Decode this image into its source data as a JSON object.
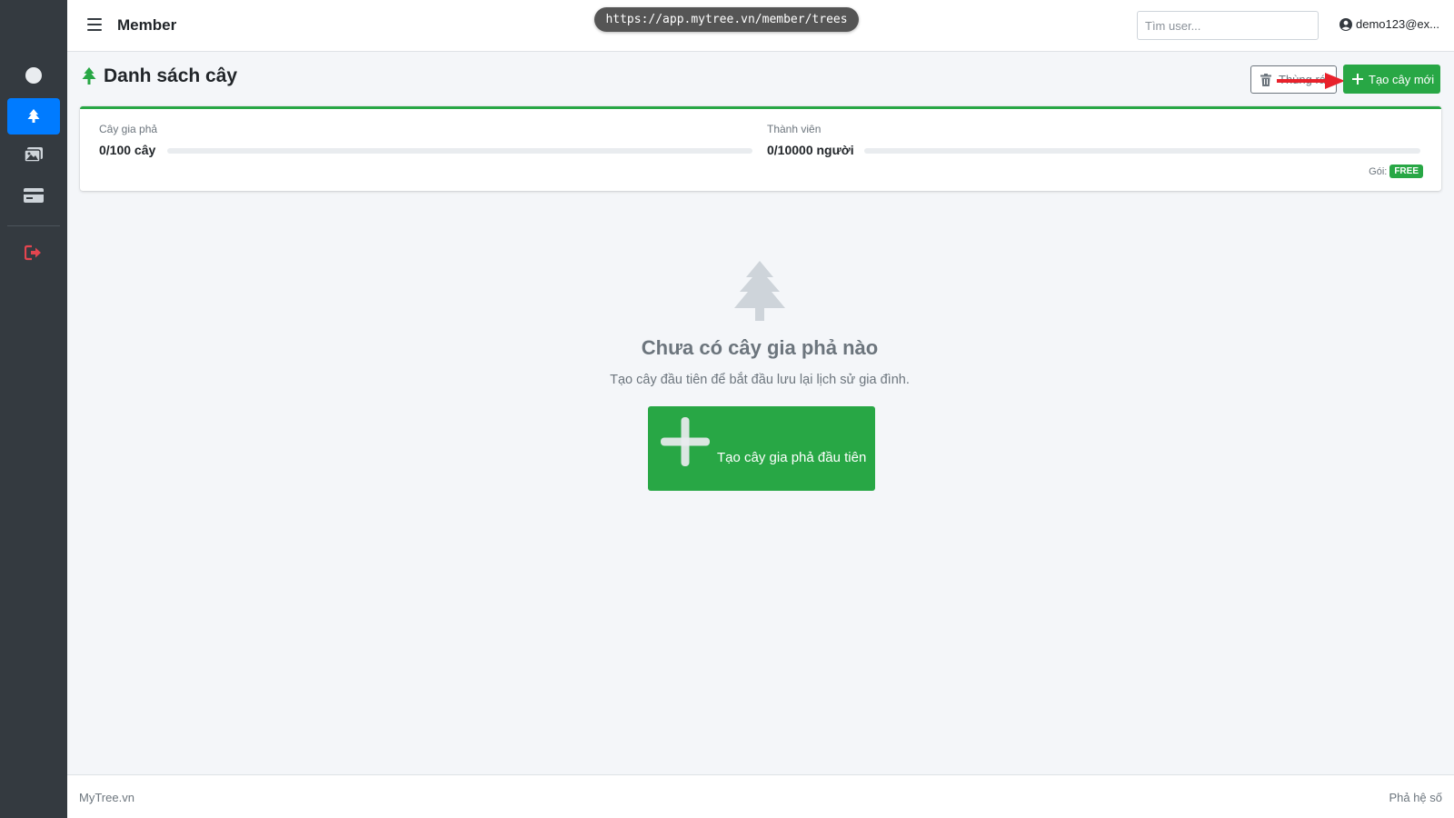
{
  "browser": {
    "url": "https://app.mytree.vn/member/trees"
  },
  "navbar": {
    "title": "Member",
    "search_placeholder": "Tìm user...",
    "user": "demo123@ex..."
  },
  "sidebar": {
    "items": [
      {
        "icon": "circle-icon",
        "active": false
      },
      {
        "icon": "tree-icon",
        "active": true
      },
      {
        "icon": "images-icon",
        "active": false
      },
      {
        "icon": "credit-card-icon",
        "active": false
      },
      {
        "icon": "logout-icon",
        "active": false,
        "color": "#e3454f"
      }
    ]
  },
  "header": {
    "title": "Danh sách cây",
    "trash_label": "Thùng rác",
    "new_label": "Tạo cây mới"
  },
  "stats": {
    "trees_label": "Cây gia phả",
    "trees_value": "0/100 cây",
    "trees_progress": 0,
    "members_label": "Thành viên",
    "members_value": "0/10000 người",
    "members_progress": 0,
    "plan_label": "Gói:",
    "plan_badge": "FREE"
  },
  "empty_state": {
    "icon": "tree-icon",
    "title": "Chưa có cây gia phả nào",
    "description": "Tạo cây đầu tiên để bắt đầu lưu lại lịch sử gia đình.",
    "button_label": "Tạo cây gia phả đầu tiên"
  },
  "footer": {
    "left": "MyTree.vn",
    "right": "Phả hệ số"
  },
  "colors": {
    "primary": "#007bff",
    "success": "#28a745",
    "sidebar": "#343a40",
    "annotation_arrow": "#e8212b"
  }
}
